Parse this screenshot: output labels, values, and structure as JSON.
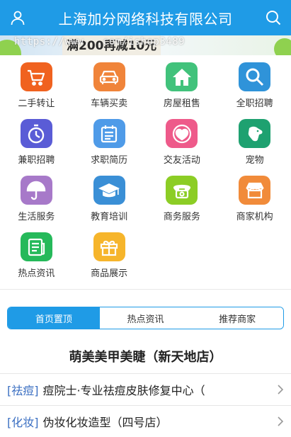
{
  "header": {
    "title": "上海加分网络科技有限公司",
    "left_icon": "user-icon",
    "right_icon": "search-icon"
  },
  "banner": {
    "watermark": "https://www.   .com/ishop3489",
    "promo": "满200再减10元"
  },
  "categories": [
    {
      "label": "二手转让",
      "icon": "shopping-cart-icon",
      "color": "#f0621f"
    },
    {
      "label": "车辆买卖",
      "icon": "car-icon",
      "color": "#f0843a"
    },
    {
      "label": "房屋租售",
      "icon": "house-icon",
      "color": "#41c27b"
    },
    {
      "label": "全职招聘",
      "icon": "magnifier-icon",
      "color": "#2f93d9"
    },
    {
      "label": "兼职招聘",
      "icon": "stopwatch-icon",
      "color": "#5a5cd6"
    },
    {
      "label": "求职简历",
      "icon": "calendar-list-icon",
      "color": "#4f9be8"
    },
    {
      "label": "交友活动",
      "icon": "heart-people-icon",
      "color": "#ee5a8a"
    },
    {
      "label": "宠物",
      "icon": "dog-icon",
      "color": "#1ea170"
    },
    {
      "label": "生活服务",
      "icon": "umbrella-icon",
      "color": "#a779c9"
    },
    {
      "label": "教育培训",
      "icon": "graduation-cap-icon",
      "color": "#3a8fd6"
    },
    {
      "label": "商务服务",
      "icon": "telephone-icon",
      "color": "#8ccd25"
    },
    {
      "label": "商家机构",
      "icon": "storefront-icon",
      "color": "#f18b3a"
    },
    {
      "label": "热点资讯",
      "icon": "news-icon",
      "color": "#25b95a"
    },
    {
      "label": "商品展示",
      "icon": "gift-icon",
      "color": "#f6b52b"
    }
  ],
  "tabs": [
    {
      "label": "首页置顶",
      "active": true
    },
    {
      "label": "热点资讯",
      "active": false
    },
    {
      "label": "推荐商家",
      "active": false
    }
  ],
  "store_title": "萌美美甲美睫（新天地店）",
  "listings": [
    {
      "tag": "[祛痘]",
      "text": "痘院士·专业祛痘皮肤修复中心（"
    },
    {
      "tag": "[化妆]",
      "text": "伪妆化妆造型（四号店）"
    }
  ],
  "colors": {
    "accent": "#1f9be6",
    "tag": "#3b6fc2"
  }
}
